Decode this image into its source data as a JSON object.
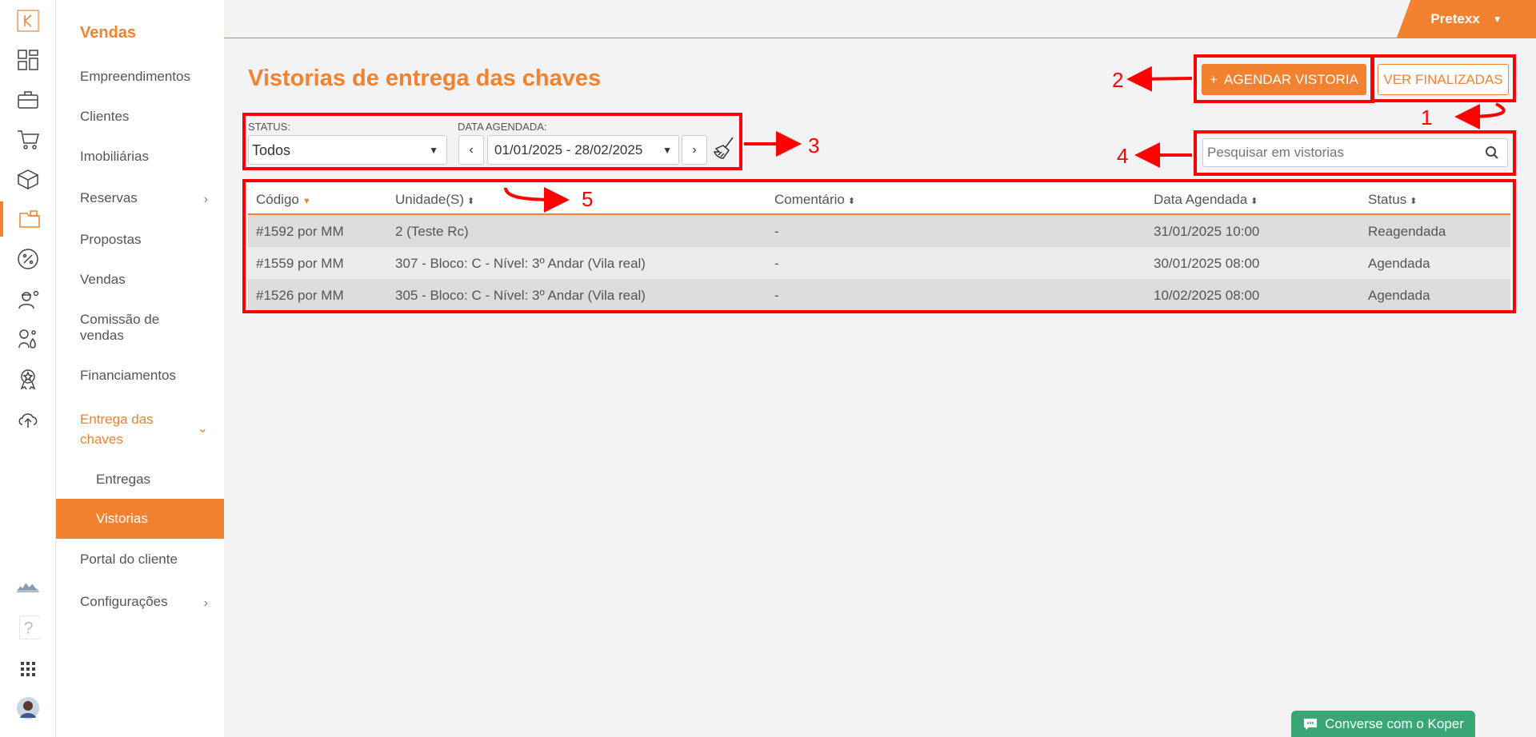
{
  "header": {
    "user": "Pretexx"
  },
  "sidebar": {
    "title": "Vendas",
    "items": {
      "empreendimentos": "Empreendimentos",
      "clientes": "Clientes",
      "imobiliarias": "Imobiliárias",
      "reservas": "Reservas",
      "propostas": "Propostas",
      "vendas": "Vendas",
      "comissao_l1": "Comissão de",
      "comissao_l2": "vendas",
      "financiamentos": "Financiamentos",
      "entrega_l1": "Entrega das",
      "entrega_l2": "chaves",
      "entregas": "Entregas",
      "vistorias": "Vistorias",
      "portal": "Portal do cliente",
      "config": "Configurações"
    }
  },
  "page": {
    "title": "Vistorias de entrega das chaves",
    "btn_agendar": "AGENDAR VISTORIA",
    "btn_finalizadas": "VER FINALIZADAS"
  },
  "filters": {
    "status_label": "STATUS:",
    "status_value": "Todos",
    "date_label": "DATA AGENDADA:",
    "date_value": "01/01/2025 - 28/02/2025",
    "search_placeholder": "Pesquisar em vistorias"
  },
  "table": {
    "headers": {
      "codigo": "Código",
      "unidade": "Unidade(S)",
      "comentario": "Comentário",
      "data": "Data Agendada",
      "status": "Status"
    },
    "rows": [
      {
        "codigo": "#1592 por MM",
        "unidade": "2 (Teste Rc)",
        "comentario": "-",
        "data": "31/01/2025 10:00",
        "status": "Reagendada"
      },
      {
        "codigo": "#1559 por MM",
        "unidade": "307 - Bloco: C - Nível: 3º Andar (Vila real)",
        "comentario": "-",
        "data": "30/01/2025 08:00",
        "status": "Agendada"
      },
      {
        "codigo": "#1526 por MM",
        "unidade": "305 - Bloco: C - Nível: 3º Andar (Vila real)",
        "comentario": "-",
        "data": "10/02/2025 08:00",
        "status": "Agendada"
      }
    ]
  },
  "annotations": {
    "n1": "1",
    "n2": "2",
    "n3": "3",
    "n4": "4",
    "n5": "5"
  },
  "chat": {
    "label": "Converse com o Koper"
  },
  "colors": {
    "accent": "#f28130",
    "annotation": "#ff0000",
    "chat": "#3aa776"
  }
}
